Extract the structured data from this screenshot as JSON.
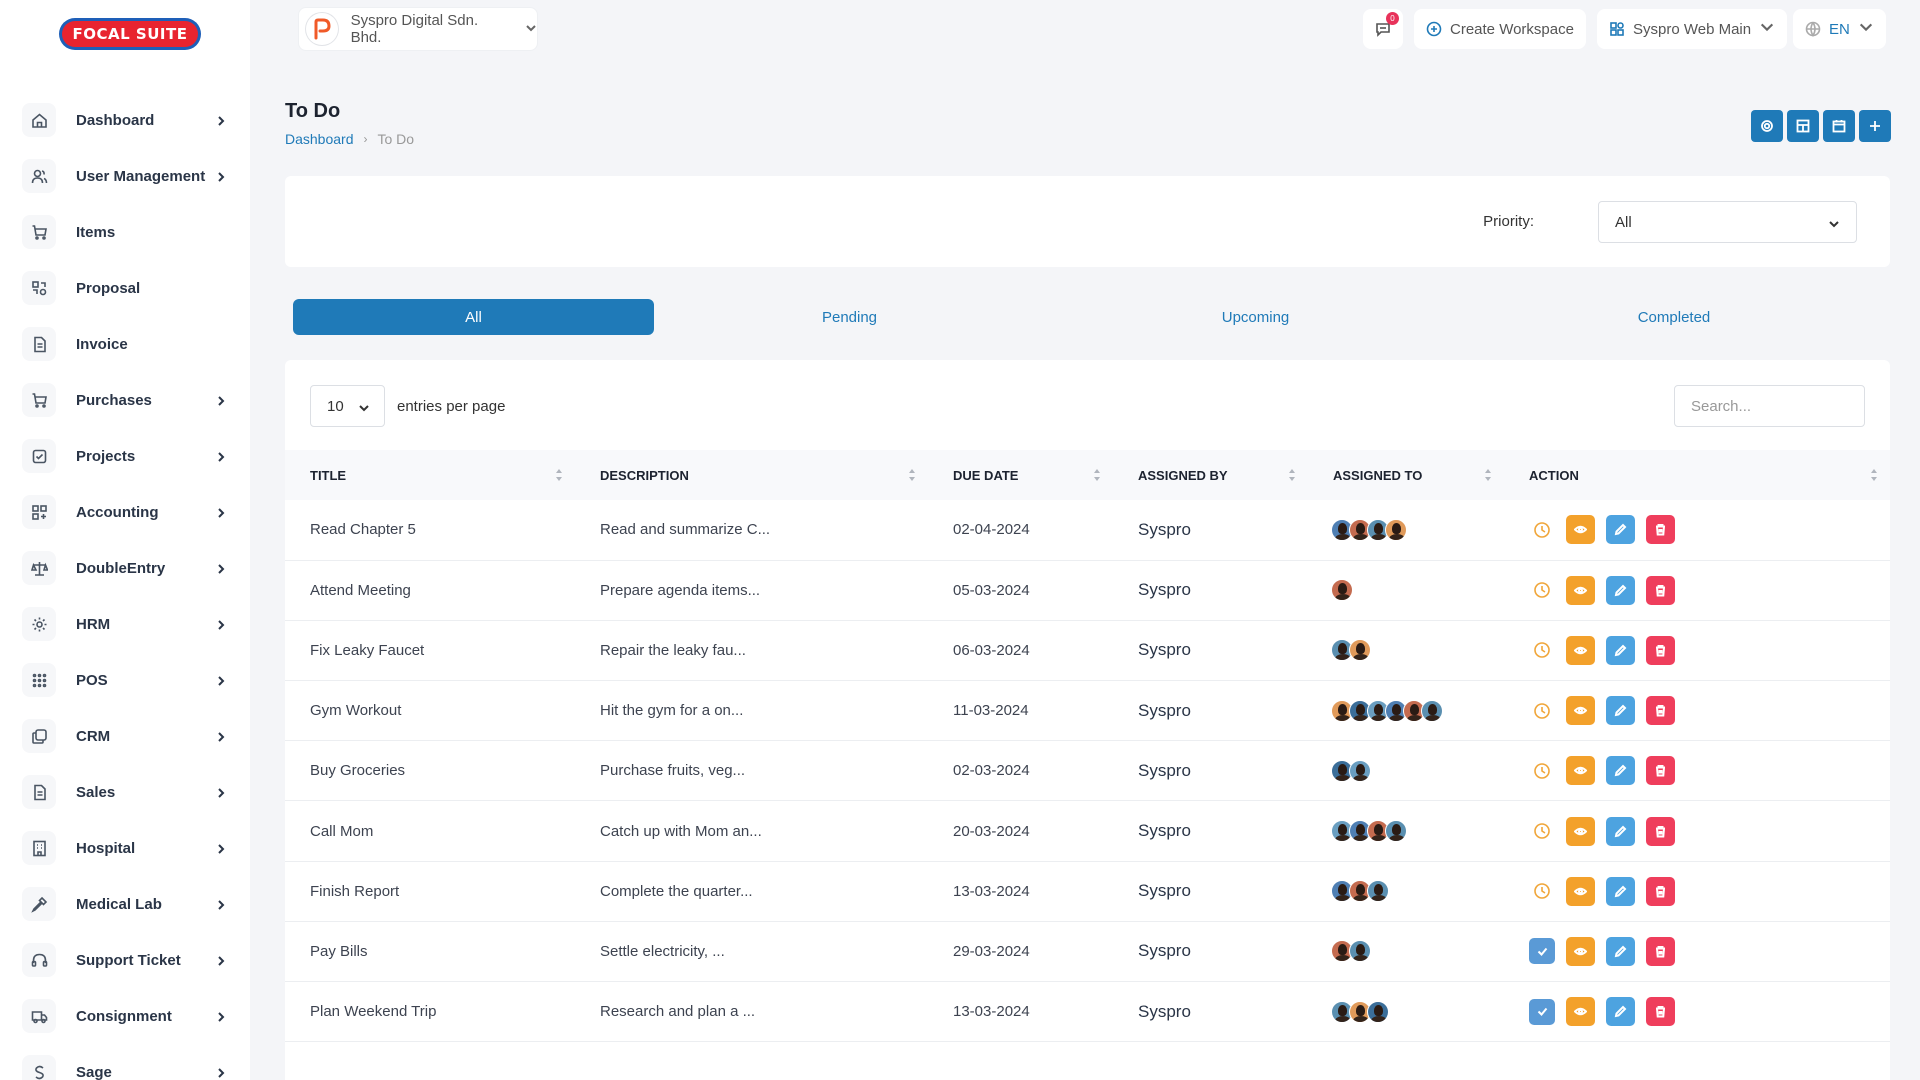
{
  "app": {
    "logo_text": "FOCAL SUITE",
    "brand_color": "#1f7ab8"
  },
  "sidebar": {
    "items": [
      {
        "label": "Dashboard",
        "icon": "home-icon",
        "has_children": true
      },
      {
        "label": "User Management",
        "icon": "users-icon",
        "has_children": true
      },
      {
        "label": "Items",
        "icon": "cart-icon",
        "has_children": false
      },
      {
        "label": "Proposal",
        "icon": "proposal-icon",
        "has_children": false
      },
      {
        "label": "Invoice",
        "icon": "file-icon",
        "has_children": false
      },
      {
        "label": "Purchases",
        "icon": "cart-icon",
        "has_children": true
      },
      {
        "label": "Projects",
        "icon": "check-square-icon",
        "has_children": true
      },
      {
        "label": "Accounting",
        "icon": "grid-icon",
        "has_children": true
      },
      {
        "label": "DoubleEntry",
        "icon": "scale-icon",
        "has_children": true
      },
      {
        "label": "HRM",
        "icon": "hrm-icon",
        "has_children": true
      },
      {
        "label": "POS",
        "icon": "dots-grid-icon",
        "has_children": true
      },
      {
        "label": "CRM",
        "icon": "layers-icon",
        "has_children": true
      },
      {
        "label": "Sales",
        "icon": "file-icon",
        "has_children": true
      },
      {
        "label": "Hospital",
        "icon": "building-icon",
        "has_children": true
      },
      {
        "label": "Medical Lab",
        "icon": "pipette-icon",
        "has_children": true
      },
      {
        "label": "Support Ticket",
        "icon": "headset-icon",
        "has_children": true
      },
      {
        "label": "Consignment",
        "icon": "truck-icon",
        "has_children": true
      },
      {
        "label": "Sage",
        "icon": "sage-icon",
        "has_children": true
      }
    ]
  },
  "topbar": {
    "company_name": "Syspro Digital Sdn. Bhd.",
    "notification_count": "0",
    "create_workspace_label": "Create Workspace",
    "workspace_name": "Syspro Web Main",
    "language": "EN"
  },
  "page": {
    "title": "To Do",
    "breadcrumb": {
      "home": "Dashboard",
      "current": "To Do"
    }
  },
  "filter": {
    "priority_label": "Priority:",
    "priority_value": "All"
  },
  "tabs": [
    {
      "label": "All",
      "active": true
    },
    {
      "label": "Pending",
      "active": false
    },
    {
      "label": "Upcoming",
      "active": false
    },
    {
      "label": "Completed",
      "active": false
    }
  ],
  "table": {
    "entries_value": "10",
    "entries_label": "entries per page",
    "search_placeholder": "Search...",
    "columns": [
      "TITLE",
      "DESCRIPTION",
      "DUE DATE",
      "ASSIGNED BY",
      "ASSIGNED TO",
      "ACTION"
    ],
    "rows": [
      {
        "title": "Read Chapter 5",
        "description": "Read and summarize C...",
        "due": "02-04-2024",
        "by": "Syspro",
        "avatars": 4,
        "status": "pending"
      },
      {
        "title": "Attend Meeting",
        "description": "Prepare agenda items...",
        "due": "05-03-2024",
        "by": "Syspro",
        "avatars": 1,
        "status": "pending"
      },
      {
        "title": "Fix Leaky Faucet",
        "description": "Repair the leaky fau...",
        "due": "06-03-2024",
        "by": "Syspro",
        "avatars": 2,
        "status": "pending"
      },
      {
        "title": "Gym Workout",
        "description": "Hit the gym for a on...",
        "due": "11-03-2024",
        "by": "Syspro",
        "avatars": 6,
        "status": "pending"
      },
      {
        "title": "Buy Groceries",
        "description": "Purchase fruits, veg...",
        "due": "02-03-2024",
        "by": "Syspro",
        "avatars": 2,
        "status": "pending"
      },
      {
        "title": "Call Mom",
        "description": "Catch up with Mom an...",
        "due": "20-03-2024",
        "by": "Syspro",
        "avatars": 4,
        "status": "pending"
      },
      {
        "title": "Finish Report",
        "description": "Complete the quarter...",
        "due": "13-03-2024",
        "by": "Syspro",
        "avatars": 3,
        "status": "pending"
      },
      {
        "title": "Pay Bills",
        "description": "Settle electricity, ...",
        "due": "29-03-2024",
        "by": "Syspro",
        "avatars": 2,
        "status": "completed"
      },
      {
        "title": "Plan Weekend Trip",
        "description": "Research and plan a ...",
        "due": "13-03-2024",
        "by": "Syspro",
        "avatars": 3,
        "status": "completed"
      }
    ]
  }
}
